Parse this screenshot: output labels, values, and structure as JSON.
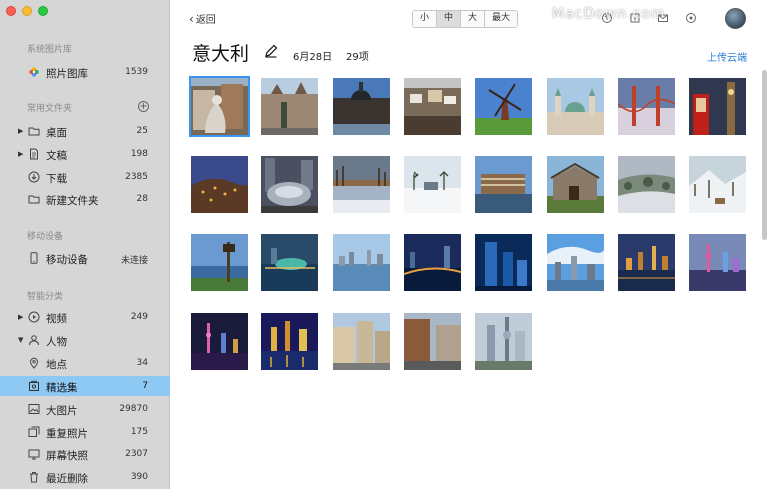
{
  "sidebar": {
    "library_title": "系统图片库",
    "library": {
      "label": "照片图库",
      "count": "1539"
    },
    "folders_title": "常用文件夹",
    "folders": [
      {
        "label": "桌面",
        "count": "25"
      },
      {
        "label": "文稿",
        "count": "198"
      },
      {
        "label": "下载",
        "count": "2385"
      },
      {
        "label": "新建文件夹",
        "count": "28"
      }
    ],
    "mobile_title": "移动设备",
    "mobile": {
      "label": "移动设备",
      "status": "未连接"
    },
    "smart_title": "智能分类",
    "smart": [
      {
        "label": "视频",
        "count": "249"
      },
      {
        "label": "人物",
        "count": ""
      },
      {
        "label": "地点",
        "count": "34"
      },
      {
        "label": "精选集",
        "count": "7"
      },
      {
        "label": "大图片",
        "count": "29870"
      },
      {
        "label": "重复照片",
        "count": "175"
      },
      {
        "label": "屏幕快照",
        "count": "2307"
      },
      {
        "label": "最近删除",
        "count": "390"
      }
    ]
  },
  "toolbar": {
    "back_label": "返回",
    "sizes": [
      "小",
      "中",
      "大",
      "最大"
    ],
    "active_size": "中",
    "watermark": "MacDown.com"
  },
  "album": {
    "title": "意大利",
    "date": "6月28日",
    "count": "29项",
    "upload_label": "上传云端"
  },
  "colors": {
    "accent": "#3a97f0",
    "selected_row": "#8ec9f4",
    "link": "#2a7fd4"
  }
}
